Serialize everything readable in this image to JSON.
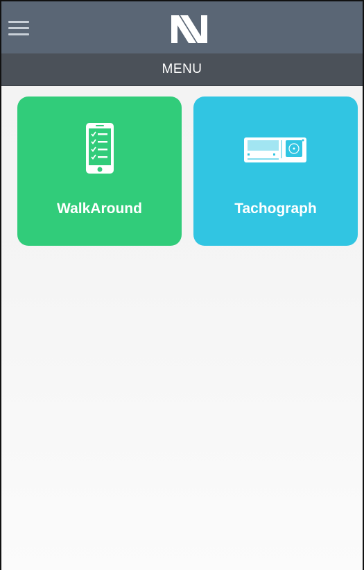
{
  "header": {
    "menu_icon": "hamburger-menu-icon",
    "logo_icon": "app-logo-n-icon",
    "title": "MENU"
  },
  "tiles": [
    {
      "label": "WalkAround",
      "icon": "phone-checklist-icon",
      "color": "#31cc7a"
    },
    {
      "label": "Tachograph",
      "icon": "tachograph-device-icon",
      "color": "#31c5e2"
    }
  ],
  "colors": {
    "topbar": "#5a6675",
    "menubar": "#4b5159"
  }
}
